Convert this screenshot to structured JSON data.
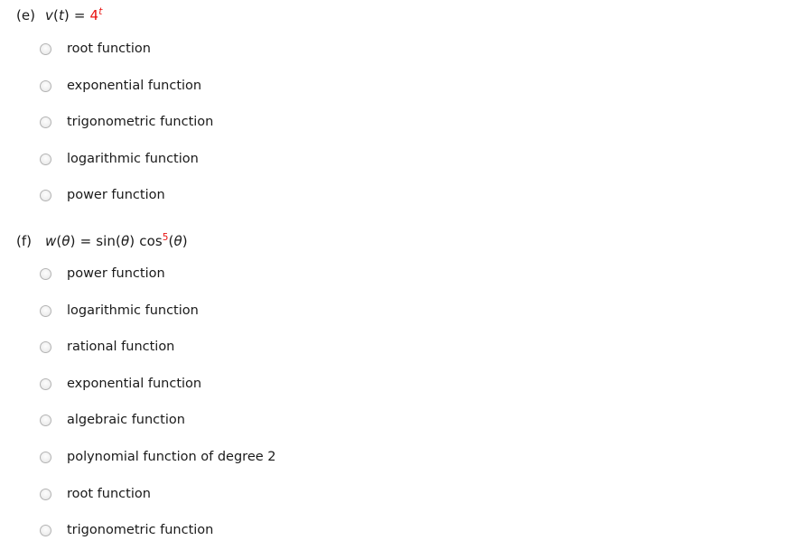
{
  "page": {
    "background_color": "#ffffff",
    "text_color": "#1a1a1a",
    "accent_color": "#e8110f",
    "radio_border_color": "#b3b3b3",
    "radio_fill_color": "#ebebeb"
  },
  "questions": [
    {
      "part_label": "(e)",
      "formula_plain": "v(t) = 4^t",
      "formula": {
        "lhs_var": "v",
        "lhs_open": "(",
        "lhs_arg": "t",
        "lhs_close": ")",
        "equals": "=",
        "base": "4",
        "exponent": "t"
      },
      "options": [
        {
          "label": "root function",
          "selected": false
        },
        {
          "label": "exponential function",
          "selected": false
        },
        {
          "label": "trigonometric function",
          "selected": false
        },
        {
          "label": "logarithmic function",
          "selected": false
        },
        {
          "label": "power function",
          "selected": false
        }
      ]
    },
    {
      "part_label": "(f)",
      "formula_plain": "w(θ) = sin(θ) cos^5(θ)",
      "formula": {
        "lhs_var": "w",
        "lhs_open": "(",
        "lhs_arg": "θ",
        "lhs_close": ")",
        "equals": "=",
        "fn1": "sin",
        "fn1_open": "(",
        "fn1_arg": "θ",
        "fn1_close": ")",
        "fn2": "cos",
        "fn2_exponent": "5",
        "fn2_open": "(",
        "fn2_arg": "θ",
        "fn2_close": ")"
      },
      "options": [
        {
          "label": "power function",
          "selected": false
        },
        {
          "label": "logarithmic function",
          "selected": false
        },
        {
          "label": "rational function",
          "selected": false
        },
        {
          "label": "exponential function",
          "selected": false
        },
        {
          "label": "algebraic function",
          "selected": false
        },
        {
          "label": "polynomial function of degree 2",
          "selected": false
        },
        {
          "label": "root function",
          "selected": false
        },
        {
          "label": "trigonometric function",
          "selected": false
        }
      ]
    }
  ]
}
